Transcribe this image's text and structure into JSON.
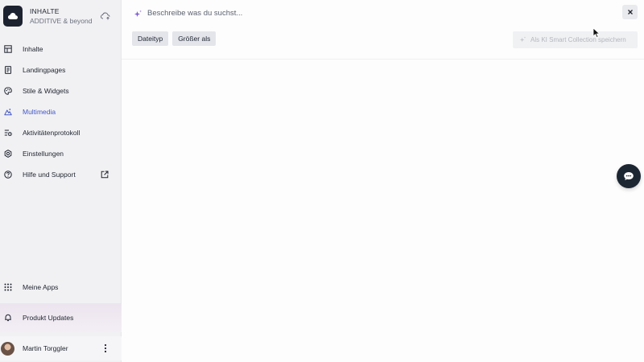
{
  "brand": {
    "title": "INHALTE",
    "subtitle": "ADDITIVE & beyond"
  },
  "nav": {
    "items": [
      {
        "label": "Inhalte",
        "icon": "layout-icon"
      },
      {
        "label": "Landingpages",
        "icon": "document-icon"
      },
      {
        "label": "Stile & Widgets",
        "icon": "palette-icon"
      },
      {
        "label": "Multimedia",
        "icon": "multimedia-icon",
        "active": true
      },
      {
        "label": "Aktivitätenprotokoll",
        "icon": "activity-list-icon"
      },
      {
        "label": "Einstellungen",
        "icon": "settings-icon"
      },
      {
        "label": "Hilfe und Support",
        "icon": "help-icon",
        "external": true
      }
    ]
  },
  "bottom": {
    "apps_label": "Meine Apps",
    "updates_label": "Produkt Updates"
  },
  "user": {
    "name": "Martin Torggler"
  },
  "search": {
    "placeholder": "Beschreibe was du suchst..."
  },
  "filters": [
    {
      "label": "Dateityp"
    },
    {
      "label": "Größer als"
    }
  ],
  "save_button": {
    "label": "Als KI Smart Collection speichern"
  },
  "colors": {
    "accent": "#4457c6",
    "brand_dark": "#1d2230",
    "sparkle": "#7b5cd6"
  }
}
